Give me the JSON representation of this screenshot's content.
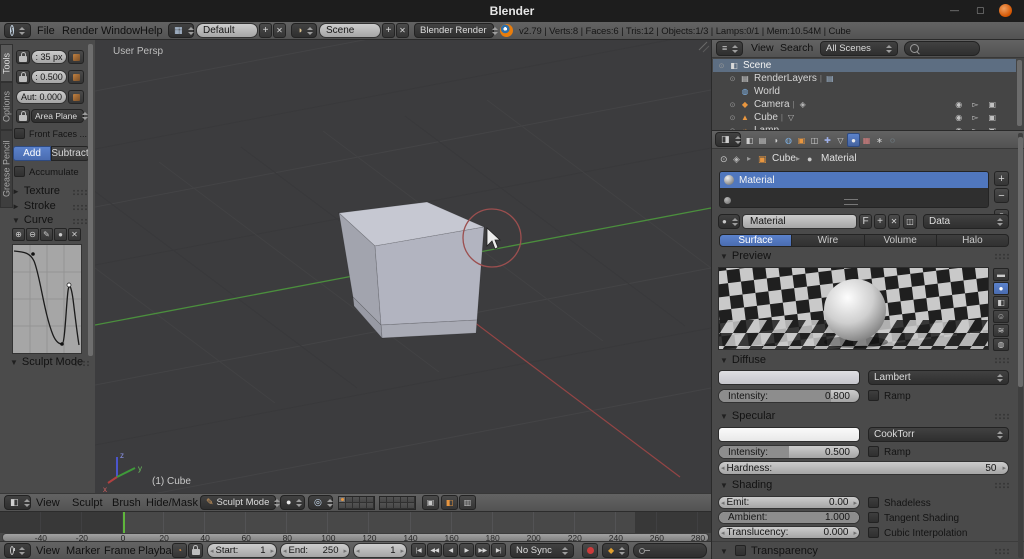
{
  "titlebar": {
    "title": "Blender"
  },
  "icons": {
    "win_min": "—",
    "win_max": "▢",
    "info": "i",
    "screen_layout": "▦",
    "scene_dd": "◑",
    "layout_add": "+",
    "layout_del": "✕",
    "scene_add": "+",
    "scene_del": "✕",
    "viewport_editor": "◧",
    "brush": "✎",
    "shading_sphere": "●",
    "pivot": "◎",
    "mode_lock": "▣",
    "ogl_render_image": "◧",
    "ogl_render_anim": "▥",
    "timeline_editor": "◔",
    "keying": "◆",
    "outliner_editor": "≡",
    "properties_editor": "◨",
    "pin": "⊙",
    "node": "◈",
    "crumb_sep": "▸",
    "crumb_object": "▣",
    "crumb_material": "●",
    "use_nodes": "◫",
    "plus": "+",
    "minus": "−",
    "close": "✕",
    "collapse": "▾",
    "panel_open": "▼",
    "panel_closed": "►"
  },
  "info_header": {
    "menus": [
      "File",
      "Render",
      "Window",
      "Help"
    ],
    "layout_name": "Default",
    "scene_name": "Scene",
    "engine": "Blender Render",
    "stats": "v2.79 | Verts:8 | Faces:6 | Tris:12 | Objects:1/3 | Lamps:0/1 | Mem:10.54M | Cube"
  },
  "tool_shelf": {
    "tabs": [
      "Tools",
      "Options",
      "Grease Pencil"
    ],
    "radius_value": ": 35 px",
    "strength_value": ": 0.500",
    "autosmooth_value": "Aut: 0.000",
    "brush_area": "Area Plane",
    "front_faces_label": "Front Faces ...",
    "add_label": "Add",
    "subtract_label": "Subtract",
    "accumulate_label": "Accumulate",
    "panels": {
      "texture": "Texture",
      "stroke": "Stroke",
      "curve": "Curve",
      "sculpt_mode": "Sculpt Mode"
    },
    "curve_tools": [
      {
        "name": "zoom-in-icon",
        "glyph": "⊕"
      },
      {
        "name": "zoom-out-icon",
        "glyph": "⊖"
      },
      {
        "name": "curve-tools-icon",
        "glyph": "✎"
      },
      {
        "name": "curve-point-icon",
        "glyph": "●"
      },
      {
        "name": "curve-delete-icon",
        "glyph": "✕"
      }
    ]
  },
  "viewport": {
    "view_label": "User Persp",
    "object_label": "(1) Cube",
    "axis_x": "x",
    "axis_y": "y",
    "axis_z": "z"
  },
  "viewport_header": {
    "menus": [
      "View",
      "Sculpt",
      "Brush",
      "Hide/Mask"
    ],
    "mode": "Sculpt Mode"
  },
  "outliner": {
    "menus": [
      "View",
      "Search"
    ],
    "filter": "All Scenes",
    "rows": [
      {
        "label": "Scene",
        "icon_name": "scene-icon",
        "glyph": "◧",
        "color": "#d8d8d8",
        "indent": 0,
        "selected": true,
        "expander": "⊙"
      },
      {
        "label": "RenderLayers",
        "icon_name": "renderlayers-icon",
        "glyph": "▤",
        "color": "#d0d0d0",
        "indent": 1,
        "expander": "⊙",
        "extra_glyph": "▤",
        "extra_name": "renderlayer-data-icon",
        "extra_color": "#9fb6cf"
      },
      {
        "label": "World",
        "icon_name": "world-icon",
        "glyph": "◍",
        "color": "#7fb2e5",
        "indent": 1
      },
      {
        "label": "Camera",
        "icon_name": "camera-icon",
        "glyph": "◆",
        "color": "#e8963f",
        "indent": 1,
        "expander": "⊙",
        "extra_glyph": "◈",
        "extra_name": "camera-data-icon",
        "extra_color": "#b8b8b8",
        "restrict": true
      },
      {
        "label": "Cube",
        "icon_name": "mesh-icon",
        "glyph": "▲",
        "color": "#e8963f",
        "indent": 1,
        "expander": "⊙",
        "extra_glyph": "▽",
        "extra_name": "mesh-data-icon",
        "extra_color": "#b8b8b8",
        "restrict": true
      },
      {
        "label": "Lamp",
        "icon_name": "lamp-icon",
        "glyph": "☼",
        "color": "#e8963f",
        "indent": 1,
        "expander": "⊙",
        "restrict": true
      }
    ],
    "restrict_icons": [
      {
        "name": "visibility-eye-icon",
        "glyph": "◉"
      },
      {
        "name": "selectability-cursor-icon",
        "glyph": "▻"
      },
      {
        "name": "render-restrict-icon",
        "glyph": "▣"
      }
    ]
  },
  "properties": {
    "tabs": [
      {
        "name": "tab-render",
        "glyph": "◧",
        "color": "#cfcfcf"
      },
      {
        "name": "tab-render-layers",
        "glyph": "▤",
        "color": "#cfcfcf"
      },
      {
        "name": "tab-scene",
        "glyph": "◑",
        "color": "#cfcfcf"
      },
      {
        "name": "tab-world",
        "glyph": "◍",
        "color": "#7fb2e5"
      },
      {
        "name": "tab-object",
        "glyph": "▣",
        "color": "#e8963f"
      },
      {
        "name": "tab-constraints",
        "glyph": "◫",
        "color": "#cfcfcf"
      },
      {
        "name": "tab-modifiers",
        "glyph": "✚",
        "color": "#9fb0e8"
      },
      {
        "name": "tab-object-data",
        "glyph": "▽",
        "color": "#cfcfcf"
      },
      {
        "name": "tab-material",
        "glyph": "●",
        "color": "#e9e9e9",
        "active": true
      },
      {
        "name": "tab-texture",
        "glyph": "▦",
        "color": "#d77f7f"
      },
      {
        "name": "tab-particles",
        "glyph": "∗",
        "color": "#cfcfcf"
      },
      {
        "name": "tab-physics",
        "glyph": "◌",
        "color": "#9fd0e8"
      }
    ],
    "breadcrumb": {
      "object": "Cube",
      "material": "Material"
    },
    "slot_name": "Material",
    "name_value": "Material",
    "fake_user_label": "F",
    "data_label": "Data",
    "type_tabs": [
      "Surface",
      "Wire",
      "Volume",
      "Halo"
    ],
    "active_type_tab": "Surface",
    "preview": {
      "title": "Preview",
      "buttons": [
        {
          "name": "preview-flat-button",
          "glyph": "▬"
        },
        {
          "name": "preview-sphere-button",
          "glyph": "●",
          "active": true
        },
        {
          "name": "preview-cube-button",
          "glyph": "◧"
        },
        {
          "name": "preview-monkey-button",
          "glyph": "☺"
        },
        {
          "name": "preview-hair-button",
          "glyph": "≋"
        },
        {
          "name": "preview-world-button",
          "glyph": "◍"
        }
      ]
    },
    "diffuse": {
      "title": "Diffuse",
      "shader": "Lambert",
      "intensity_label": "Intensity:",
      "intensity": "0.800",
      "ramp_label": "Ramp"
    },
    "specular": {
      "title": "Specular",
      "shader": "CookTorr",
      "intensity_label": "Intensity:",
      "intensity": "0.500",
      "ramp_label": "Ramp",
      "hardness_label": "Hardness:",
      "hardness": "50"
    },
    "shading": {
      "title": "Shading",
      "emit_label": "Emit:",
      "emit": "0.00",
      "ambient_label": "Ambient:",
      "ambient": "1.000",
      "translucency_label": "Translucency:",
      "translucency": "0.000",
      "shadeless_label": "Shadeless",
      "tangent_label": "Tangent Shading",
      "cubic_label": "Cubic Interpolation"
    },
    "transparency": {
      "title": "Transparency"
    }
  },
  "timeline": {
    "ticks": [
      -40,
      -20,
      0,
      20,
      40,
      60,
      80,
      100,
      120,
      140,
      160,
      180,
      200,
      220,
      240,
      260,
      280
    ],
    "range_start": 1,
    "range_end": 250,
    "current_frame": 1,
    "header": {
      "menus": [
        "View",
        "Marker",
        "Frame",
        "Playback"
      ],
      "start_label": "Start:",
      "start": "1",
      "end_label": "End:",
      "end": "250",
      "current": "1",
      "sync": "No Sync",
      "playback": [
        {
          "name": "jump-to-start-button",
          "glyph": "|◀"
        },
        {
          "name": "jump-to-prev-keyframe-button",
          "glyph": "◀◀"
        },
        {
          "name": "play-reverse-button",
          "glyph": "◀"
        },
        {
          "name": "play-button",
          "glyph": "▶"
        },
        {
          "name": "jump-to-next-keyframe-button",
          "glyph": "▶▶"
        },
        {
          "name": "jump-to-end-button",
          "glyph": "▶|"
        }
      ]
    }
  }
}
